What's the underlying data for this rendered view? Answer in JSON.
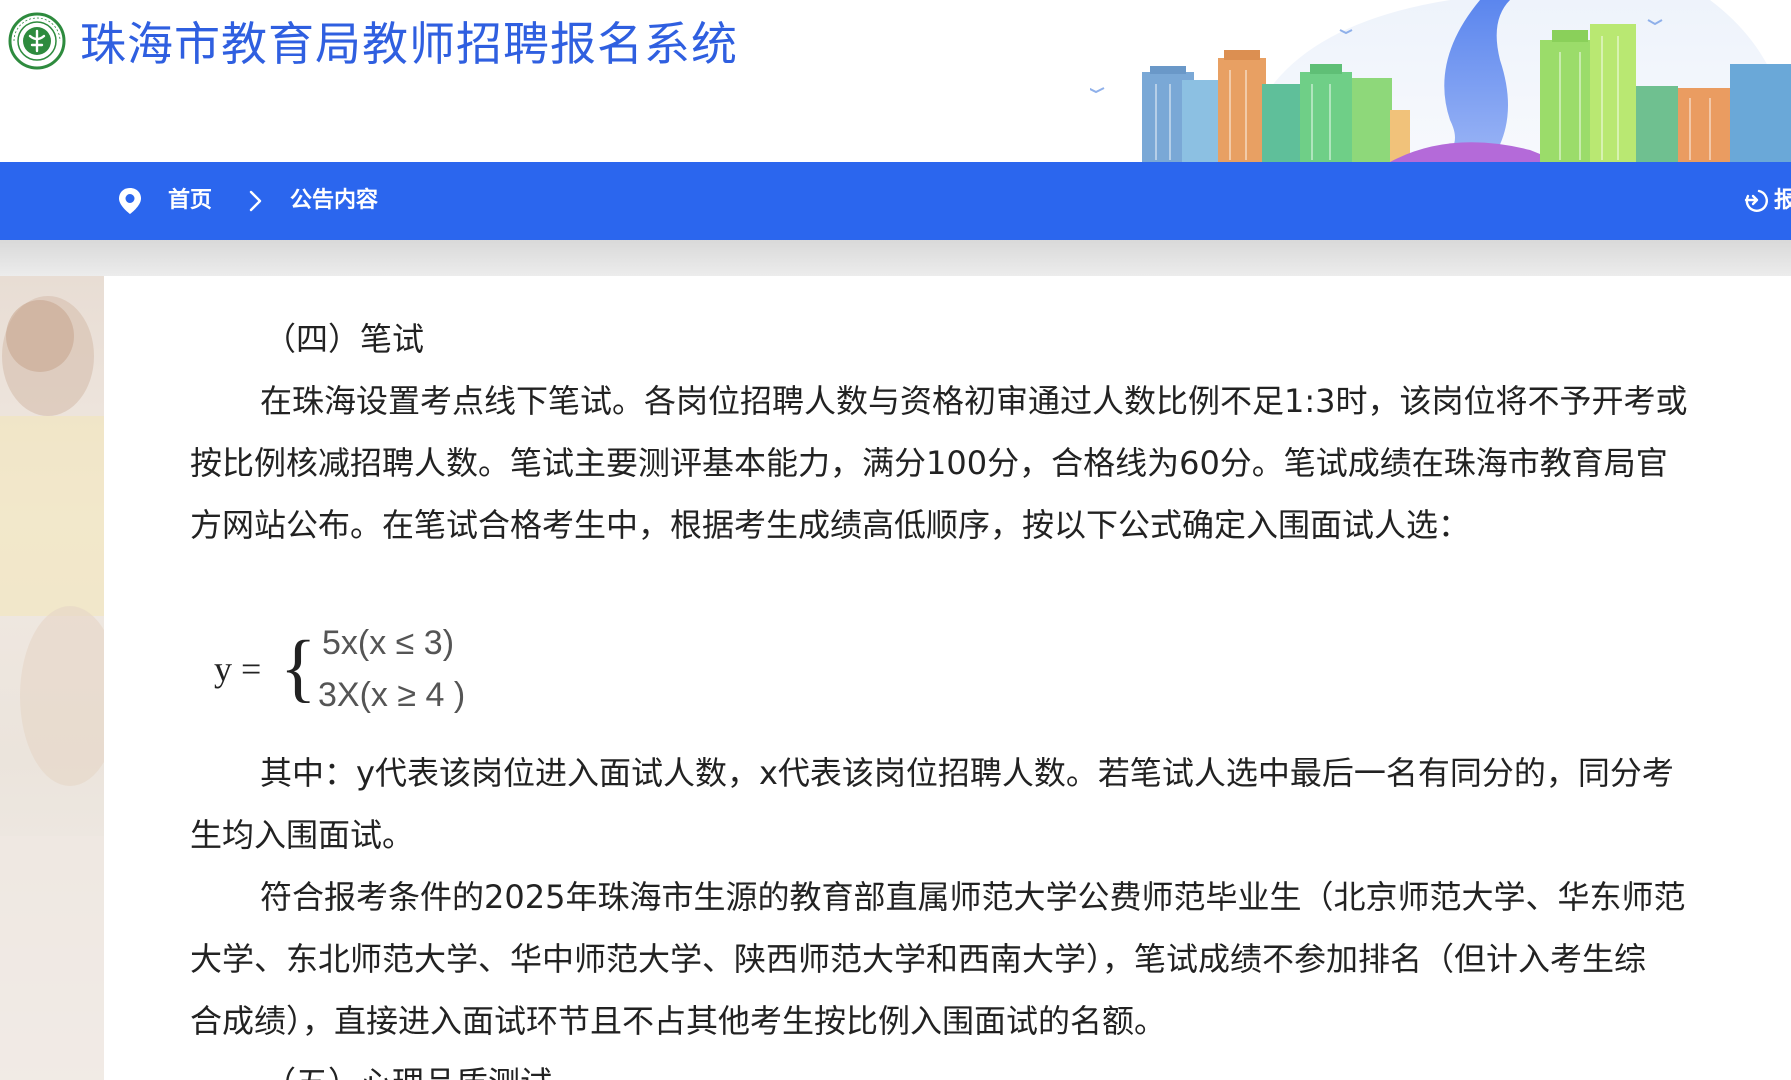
{
  "header": {
    "title": "珠海市教育局教师招聘报名系统",
    "logo_icon": "zhuhai-education-logo",
    "brand_color": "#2f5fe0"
  },
  "navbar": {
    "background": "#2b66ee",
    "breadcrumb": {
      "home": "首页",
      "separator": ">",
      "current": "公告内容"
    },
    "right_label": "报"
  },
  "article": {
    "section_heading": "（四）笔试",
    "para1_lines": [
      "在珠海设置考点线下笔试。各岗位招聘人数与资格初审通过人数比例不足1:3时，该岗位将不予开考或",
      "按比例核减招聘人数。笔试主要测评基本能力，满分100分，合格线为60分。笔试成绩在珠海市教育局官",
      "方网站公布。在笔试合格考生中，根据考生成绩高低顺序，按以下公式确定入围面试人选："
    ],
    "formula": {
      "lhs": "y =",
      "brace": "{",
      "case1": "5x(x ≤ 3)",
      "case2": "3X(x ≥ 4 )"
    },
    "para2_lines": [
      "其中：y代表该岗位进入面试人数，x代表该岗位招聘人数。若笔试人选中最后一名有同分的，同分考",
      "生均入围面试。"
    ],
    "para3_lines": [
      "符合报考条件的2025年珠海市生源的教育部直属师范大学公费师范毕业生（北京师范大学、华东师范",
      "大学、东北师范大学、华中师范大学、陕西师范大学和西南大学），笔试成绩不参加排名（但计入考生综",
      "合成绩），直接进入面试环节且不占其他考生按比例入围面试的名额。"
    ],
    "next_heading": "（五）心理品质测试"
  }
}
